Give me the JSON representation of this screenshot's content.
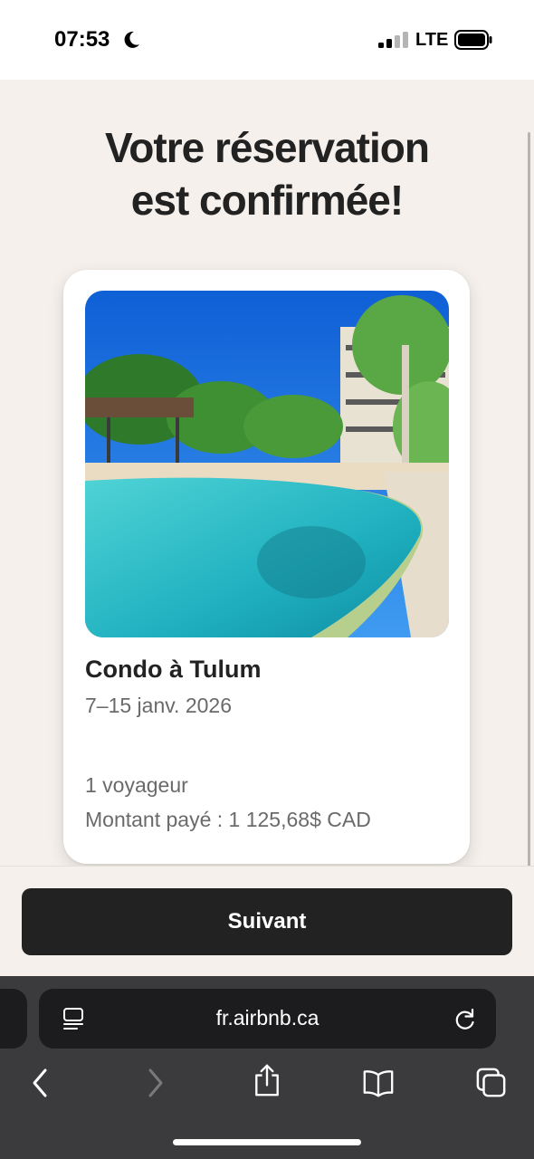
{
  "status_bar": {
    "time": "07:53",
    "network": "LTE",
    "icons": [
      "moon-icon",
      "signal-icon",
      "battery-icon"
    ]
  },
  "page": {
    "headline_line1": "Votre réservation",
    "headline_line2": "est confirmée!"
  },
  "listing": {
    "title": "Condo à Tulum",
    "dates": "7–15 janv. 2026",
    "guests": "1 voyageur",
    "amount": "Montant payé : 1 125,68$ CAD",
    "photo": "pool-photo"
  },
  "footer": {
    "next_label": "Suivant"
  },
  "browser": {
    "url": "fr.airbnb.ca",
    "icons": [
      "reader-icon",
      "reload-icon",
      "back-icon",
      "forward-icon",
      "share-icon",
      "bookmarks-icon",
      "tabs-icon"
    ]
  },
  "colors": {
    "background": "#f5f0eb",
    "button": "#222222",
    "text_primary": "#222222",
    "text_secondary": "#6a6a6a",
    "browser_chrome": "#3b3b3d"
  }
}
